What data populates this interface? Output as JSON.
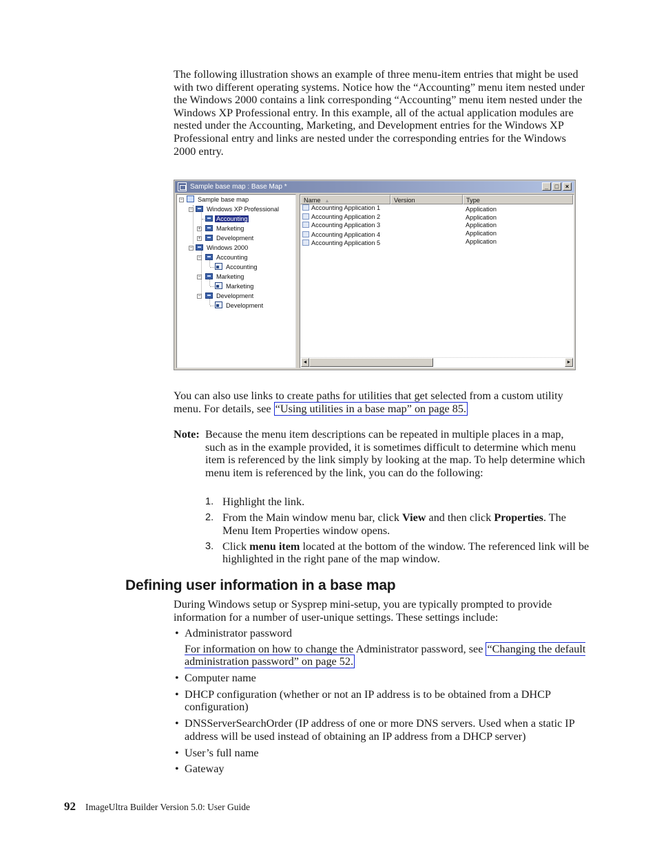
{
  "intro_paragraph": "The following illustration shows an example of three menu-item entries that might be used with two different operating systems. Notice how the “Accounting” menu item nested under the Windows 2000 contains a link corresponding “Accounting” menu item nested under the Windows XP Professional entry. In this example, all of the actual application modules are nested under the Accounting, Marketing, and Development entries for the Windows XP Professional entry and links are nested under the corresponding entries for the Windows 2000 entry.",
  "window": {
    "title": "Sample base map : Base Map *",
    "buttons": {
      "minimize": "_",
      "maximize": "□",
      "close": "×"
    },
    "tree": [
      {
        "label": "Sample base map",
        "icon": "base-map-icon",
        "expander": "−"
      },
      {
        "label": "Windows XP Professional",
        "icon": "menu-item-icon",
        "expander": "−"
      },
      {
        "label": "Accounting",
        "icon": "menu-item-icon",
        "selected": true
      },
      {
        "label": "Marketing",
        "icon": "menu-item-icon",
        "expander": "+"
      },
      {
        "label": "Development",
        "icon": "menu-item-icon",
        "expander": "+"
      },
      {
        "label": "Windows 2000",
        "icon": "menu-item-icon",
        "expander": "−"
      },
      {
        "label": "Accounting",
        "icon": "menu-item-icon",
        "expander": "−"
      },
      {
        "label": "Accounting",
        "icon": "link-icon"
      },
      {
        "label": "Marketing",
        "icon": "menu-item-icon",
        "expander": "−"
      },
      {
        "label": "Marketing",
        "icon": "link-icon"
      },
      {
        "label": "Development",
        "icon": "menu-item-icon",
        "expander": "−"
      },
      {
        "label": "Development",
        "icon": "link-icon"
      }
    ],
    "columns": {
      "name": "Name",
      "version": "Version",
      "type": "Type",
      "sort_indicator": "▲"
    },
    "rows": [
      {
        "name": "Accounting Application 1",
        "version": "",
        "type": "Application"
      },
      {
        "name": "Accounting Application 2",
        "version": "",
        "type": "Application"
      },
      {
        "name": "Accounting Application 3",
        "version": "",
        "type": "Application"
      },
      {
        "name": "Accounting Application 4",
        "version": "",
        "type": "Application"
      },
      {
        "name": "Accounting Application 5",
        "version": "",
        "type": "Application"
      }
    ],
    "scroll_left": "◄",
    "scroll_right": "►"
  },
  "paragraph2": {
    "text": "You can also use links to create paths for utilities that get selected from a custom utility menu. For details, see ",
    "link": "“Using utilities in a base map” on page 85."
  },
  "note": {
    "label": "Note:",
    "body": "Because the menu item descriptions can be repeated in multiple places in a map, such as in the example provided, it is sometimes difficult to determine which menu item is referenced by the link simply by looking at the map. To help determine which menu item is referenced by the link, you can do the following:",
    "steps": [
      {
        "num": "1.",
        "pre": "Highlight the link.",
        "bold1": "",
        "mid": "",
        "bold2": "",
        "post": ""
      },
      {
        "num": "2.",
        "pre": "From the Main window menu bar, click ",
        "bold1": "View",
        "mid": " and then click ",
        "bold2": "Properties",
        "post": ". The Menu Item Properties window opens."
      },
      {
        "num": "3.",
        "pre": "Click ",
        "bold1": "menu item",
        "mid": " located at the bottom of the window. The referenced link will be highlighted in the right pane of the map window.",
        "bold2": "",
        "post": ""
      }
    ]
  },
  "section": {
    "heading": "Defining user information in a base map",
    "intro": "During Windows setup or Sysprep mini-setup, you are typically prompted to provide information for a number of user-unique settings. These settings include:",
    "bullets": [
      {
        "text": "Administrator password",
        "sub_pre": "For information on how to change the Administrator password, see ",
        "sub_link": "“Changing the default administration password” on page 52."
      },
      {
        "text": "Computer name"
      },
      {
        "text": "DHCP configuration (whether or not an IP address is to be obtained from a DHCP configuration)"
      },
      {
        "text": "DNSServerSearchOrder (IP address of one or more DNS servers. Used when a static IP address will be used instead of obtaining an IP address from a DHCP server)"
      },
      {
        "text": "User’s full name"
      },
      {
        "text": "Gateway"
      }
    ],
    "bullet_glyph": "•"
  },
  "footer": {
    "page_number": "92",
    "title": "ImageUltra Builder Version 5.0: User Guide"
  },
  "colors": {
    "link_border": "#1a2bd6",
    "selection": "#26328a"
  }
}
